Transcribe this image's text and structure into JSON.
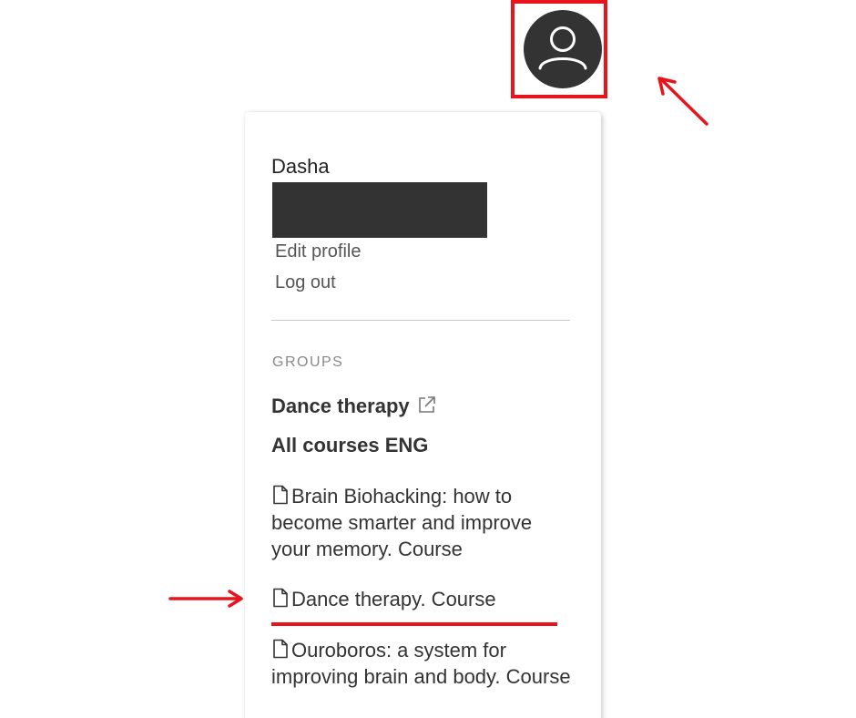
{
  "user": {
    "name": "Dasha"
  },
  "profile_menu": {
    "edit_profile_label": "Edit profile",
    "log_out_label": "Log out"
  },
  "groups": {
    "heading": "GROUPS",
    "items": [
      {
        "label": "Dance therapy",
        "icon": "external-link-icon"
      },
      {
        "label": "All courses ENG"
      }
    ]
  },
  "courses": [
    {
      "label": "Brain Biohacking: how to become smarter and improve your memory. Course",
      "icon": "document-icon"
    },
    {
      "label": "Dance therapy. Course",
      "icon": "document-icon"
    },
    {
      "label": "Ouroboros: a system for improving brain and body. Course",
      "icon": "document-icon"
    }
  ],
  "colors": {
    "annotation_red": "#e8141c",
    "avatar_bg": "#333333",
    "text_dark": "#333333",
    "text_muted": "#555555",
    "heading_gray": "#888888"
  },
  "icons": {
    "avatar": "user-avatar-icon",
    "external": "external-link-icon",
    "document": "document-icon",
    "arrow": "arrow-icon"
  }
}
